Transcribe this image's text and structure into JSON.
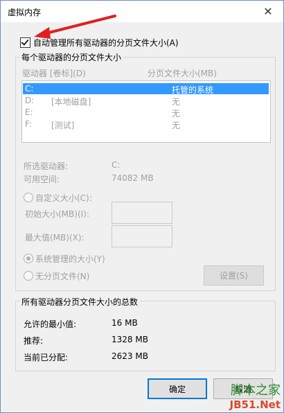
{
  "window": {
    "title": "虚拟内存",
    "close_glyph": "✕"
  },
  "auto_manage": {
    "label": "自动管理所有驱动器的分页文件大小(A)",
    "checked": true
  },
  "per_drive": {
    "legend": "每个驱动器的分页文件大小",
    "col_drive": "驱动器 [卷标](D)",
    "col_size": "分页文件大小(MB)",
    "drives": [
      {
        "drive": "C:",
        "label": "",
        "size": "托管的系统",
        "selected": true
      },
      {
        "drive": "D:",
        "label": "[本地磁盘]",
        "size": "无",
        "selected": false
      },
      {
        "drive": "E:",
        "label": "",
        "size": "无",
        "selected": false
      },
      {
        "drive": "F:",
        "label": "[测试]",
        "size": "无",
        "selected": false
      }
    ],
    "selected_drive_label": "所选驱动器:",
    "selected_drive_value": "C:",
    "free_space_label": "可用空间:",
    "free_space_value": "74082 MB",
    "custom_size_label": "自定义大小(C):",
    "initial_size_label": "初始大小(MB)(I):",
    "max_size_label": "最大值(MB)(X):",
    "system_managed_label": "系统管理的大小(Y)",
    "no_paging_label": "无分页文件(N)",
    "set_button": "设置(S)"
  },
  "totals": {
    "legend": "所有驱动器分页文件大小的总数",
    "min_label": "允许的最小值:",
    "min_value": "16 MB",
    "recommended_label": "推荐:",
    "recommended_value": "1328 MB",
    "current_label": "当前已分配:",
    "current_value": "2623 MB"
  },
  "buttons": {
    "ok": "确定",
    "cancel": "取消"
  },
  "watermark": {
    "line1": "脚本之家",
    "line2": "JB51.Net"
  },
  "colors": {
    "selection": "#3399ff",
    "annotation_arrow": "#e02020",
    "focus": "#0078d7"
  }
}
